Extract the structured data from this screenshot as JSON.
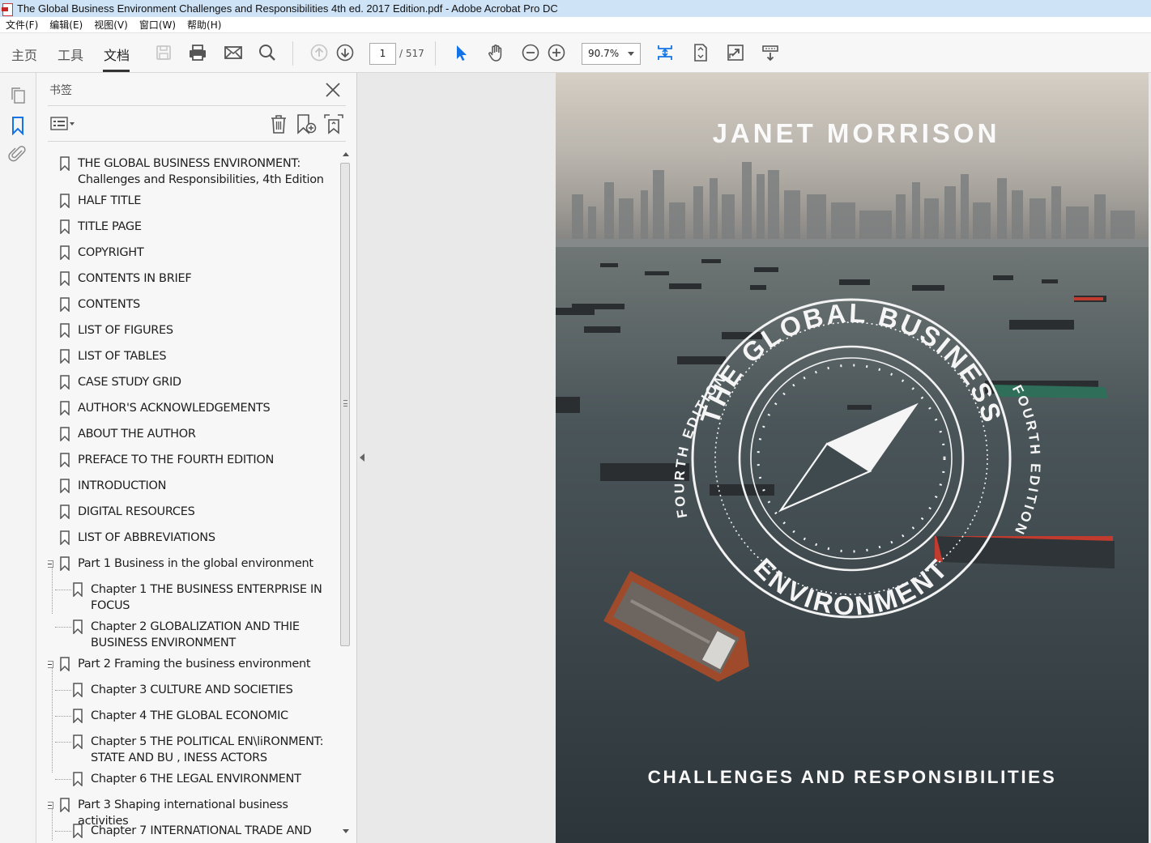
{
  "window": {
    "title": "The Global Business Environment Challenges and Responsibilities 4th ed. 2017 Edition.pdf - Adobe Acrobat Pro DC"
  },
  "menu": [
    "文件(F)",
    "编辑(E)",
    "视图(V)",
    "窗口(W)",
    "帮助(H)"
  ],
  "tabs": {
    "home": "主页",
    "tools": "工具",
    "document": "文档"
  },
  "toolbar": {
    "page_current": "1",
    "page_total": "/ 517",
    "zoom": "90.7%"
  },
  "bookmarks_panel": {
    "title": "书签",
    "items": [
      {
        "line1": "THE GLOBAL BUSINESS ENVIRONMENT:",
        "line2": "Challenges and Responsibilities, 4th Edition"
      },
      {
        "line1": "HALF TITLE"
      },
      {
        "line1": "TITLE PAGE"
      },
      {
        "line1": "COPYRIGHT"
      },
      {
        "line1": "CONTENTS IN BRIEF"
      },
      {
        "line1": "CONTENTS"
      },
      {
        "line1": "LIST OF FIGURES"
      },
      {
        "line1": "LIST OF TABLES"
      },
      {
        "line1": "CASE STUDY GRID"
      },
      {
        "line1": "AUTHOR'S ACKNOWLEDGEMENTS"
      },
      {
        "line1": "ABOUT THE AUTHOR"
      },
      {
        "line1": "PREFACE TO THE FOURTH EDITION"
      },
      {
        "line1": "INTRODUCTION"
      },
      {
        "line1": "DIGITAL RESOURCES"
      },
      {
        "line1": "LIST OF ABBREVIATIONS"
      },
      {
        "line1": "Part 1 Business in the global environment"
      },
      {
        "line1": "Chapter 1 THE BUSINESS ENTERPRISE IN",
        "line2": "FOCUS"
      },
      {
        "line1": "Chapter 2 GLOBALIZATION AND THIE",
        "line2": "BUSINESS ENVIRONMENT"
      },
      {
        "line1": "Part 2 Framing the business environment"
      },
      {
        "line1": "Chapter 3 CULTURE AND SOCIETIES"
      },
      {
        "line1": "Chapter 4 THE GLOBAL ECONOMIC"
      },
      {
        "line1": "Chapter 5 THE POLITICAL EN\\liRONMENT:",
        "line2": "STATE AND BU , INESS ACTORS"
      },
      {
        "line1": "Chapter 6 THE LEGAL ENVIRONMENT"
      },
      {
        "line1": "Part 3 Shaping international business activities"
      },
      {
        "line1": "Chapter 7 INTERNATIONAL TRADE AND"
      }
    ]
  },
  "cover": {
    "author": "JANET MORRISON",
    "title_arc_top": "THE GLOBAL BUSINESS",
    "title_arc_bottom": "ENVIRONMENT",
    "edition": "FOURTH EDITION",
    "subtitle": "CHALLENGES AND RESPONSIBILITIES"
  },
  "colors": {
    "titlebar": "#cfe3f7",
    "accent_blue": "#1473e6",
    "panel_bg": "#f7f7f7",
    "sea": "#3e484c"
  }
}
